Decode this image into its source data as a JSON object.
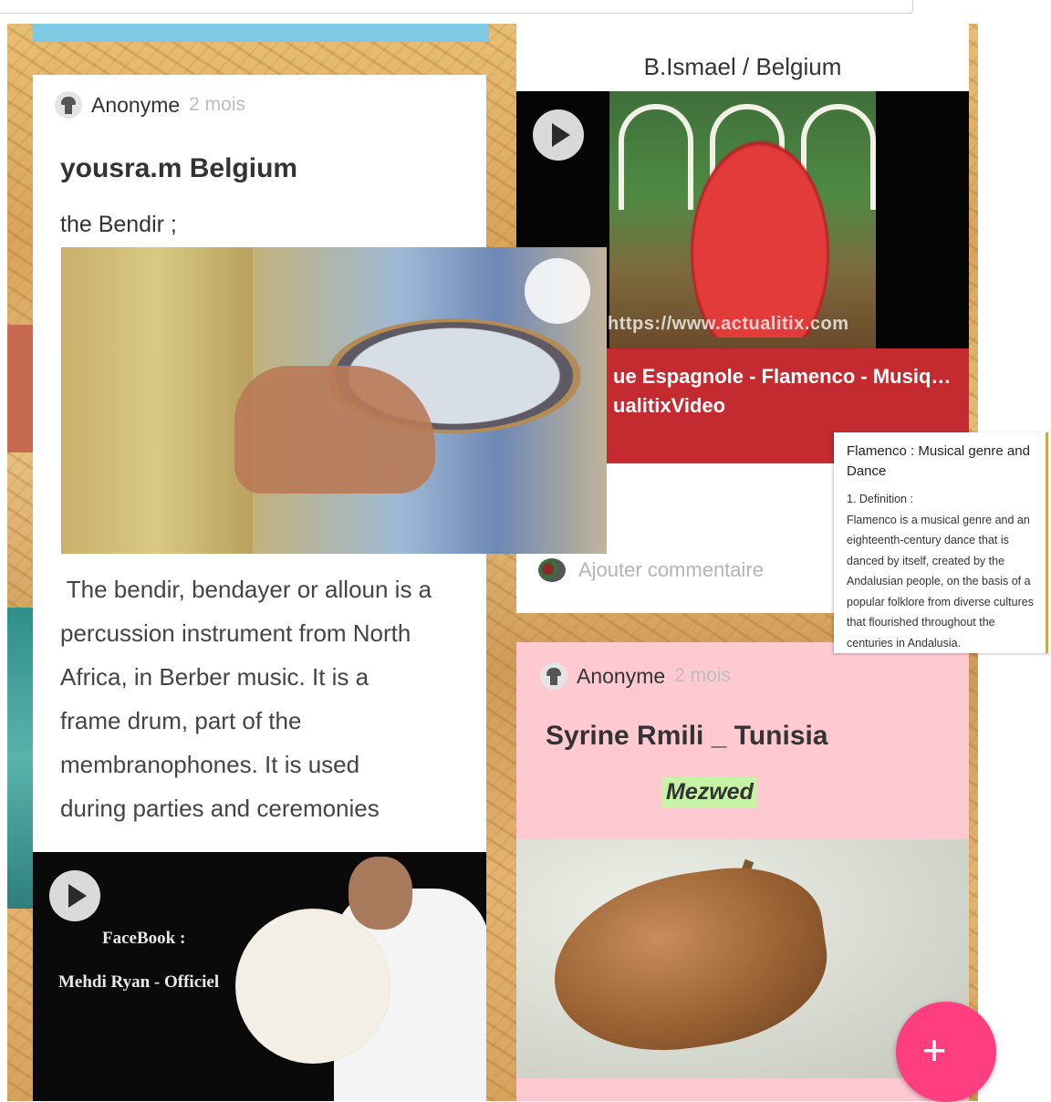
{
  "left_post": {
    "author": "Anonyme",
    "time": "2 mois",
    "title": "yousra.m Belgium",
    "subtitle": "the Bendir ;",
    "body_lines": [
      " The bendir, bendayer or alloun is a",
      "percussion instrument from North",
      "Africa, in Berber music. It is a",
      "frame drum, part of the",
      "membranophones. It is used",
      "during parties and ceremonies"
    ],
    "video": {
      "overlay_line1": "FaceBook :",
      "overlay_line2": "Mehdi Ryan - Officiel"
    }
  },
  "right_top_post": {
    "header": "B.Ismael / Belgium",
    "video_watermark": "https://www.actualitix.com",
    "video_title": "ue Espagnole - Flamenco - Musiq…",
    "video_source": "ualitixVideo",
    "add_comment": "Ajouter commentaire"
  },
  "right_bottom_post": {
    "author": "Anonyme",
    "time": "2 mois",
    "title": "Syrine Rmili _ Tunisia",
    "highlight": "Mezwed"
  },
  "info_box": {
    "heading": "Flamenco : Musical genre and Dance",
    "definition_label": "1. Definition :",
    "definition_text": "Flamenco is a musical genre and an eighteenth-century dance that is danced by itself, created by the Andalusian people, on the basis of a popular folklore from diverse cultures that flourished throughout the centuries in Andalusia."
  },
  "fab": {
    "label": "+"
  },
  "colors": {
    "accent_pink": "#ff3e7f",
    "video_caption_red": "#c42b31",
    "pink_card": "#ffc9d2",
    "highlight_green": "#c6f3a6"
  }
}
